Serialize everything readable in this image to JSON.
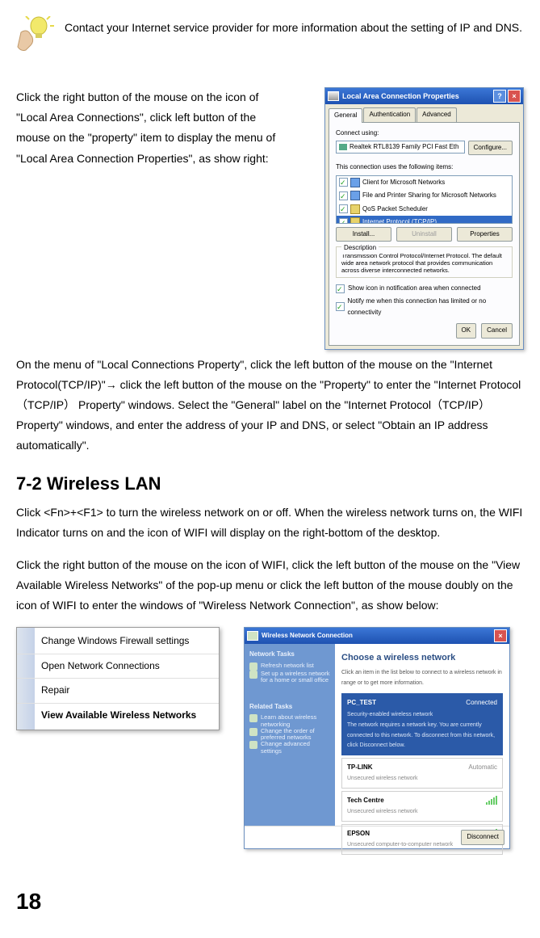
{
  "tip": {
    "text": "Contact your Internet service provider for more information about the setting of IP and DNS."
  },
  "para1": "Click the right button of the mouse on the icon of \"Local Area Connections\", click left button of the mouse on the \"property\" item to display the menu of \"Local Area Connection Properties\", as show right:",
  "para2": "On the menu of \"Local Connections Property\", click the left button of the mouse on the \"Internet Protocol(TCP/IP)\"→ click the left button of the mouse on the \"Property\" to enter the \"Internet Protocol（TCP/IP） Property\" windows. Select the \"General\" label on the \"Internet Protocol（TCP/IP） Property\" windows, and enter the address of your IP and DNS, or select \"Obtain an IP address automatically\".",
  "heading": "7-2 Wireless LAN",
  "para3": "Click <Fn>+<F1> to turn the wireless network on or off. When the wireless network turns on, the WIFI Indicator turns on and the icon of WIFI will display on the right-bottom of the desktop.",
  "para4": "Click the right button of the mouse on the icon of WIFI, click the left button of the mouse on the \"View Available Wireless Networks\" of the pop-up menu or click the left button of the mouse doubly on the icon of WIFI to enter the windows of \"Wireless Network Connection\", as show below:",
  "page_number": "18",
  "lan_dialog": {
    "title": "Local Area Connection Properties",
    "tabs": {
      "general": "General",
      "auth": "Authentication",
      "adv": "Advanced"
    },
    "connect_using_label": "Connect using:",
    "adapter": "Realtek RTL8139 Family PCI Fast Eth",
    "configure_btn": "Configure...",
    "items_label": "This connection uses the following items:",
    "items": [
      "Client for Microsoft Networks",
      "File and Printer Sharing for Microsoft Networks",
      "QoS Packet Scheduler",
      "Internet Protocol (TCP/IP)"
    ],
    "install_btn": "Install...",
    "uninstall_btn": "Uninstall",
    "properties_btn": "Properties",
    "desc_label": "Description",
    "desc_text": "Transmission Control Protocol/Internet Protocol. The default wide area network protocol that provides communication across diverse interconnected networks.",
    "chk1": "Show icon in notification area when connected",
    "chk2": "Notify me when this connection has limited or no connectivity",
    "ok": "OK",
    "cancel": "Cancel"
  },
  "context_menu": {
    "items": [
      "Change Windows Firewall settings",
      "Open Network Connections",
      "Repair",
      "View Available Wireless Networks"
    ]
  },
  "wlan_window": {
    "title": "Wireless Network Connection",
    "side": {
      "h1": "Network Tasks",
      "l1": "Refresh network list",
      "l2": "Set up a wireless network for a home or small office",
      "h2": "Related Tasks",
      "l3": "Learn about wireless networking",
      "l4": "Change the order of preferred networks",
      "l5": "Change advanced settings"
    },
    "main": {
      "heading": "Choose a wireless network",
      "sub": "Click an item in the list below to connect to a wireless network in range or to get more information.",
      "connected": "Connected",
      "auto": "Automatic",
      "nets": [
        {
          "name": "PC_TEST",
          "sub": "Security-enabled wireless network",
          "extra": "The network requires a network key. You are currently connected to this network. To disconnect from this network, click Disconnect below."
        },
        {
          "name": "TP-LINK",
          "sub": "Unsecured wireless network"
        },
        {
          "name": "Tech Centre",
          "sub": "Unsecured wireless network"
        },
        {
          "name": "EPSON",
          "sub": "Unsecured computer-to-computer network"
        }
      ],
      "disconnect": "Disconnect"
    }
  }
}
